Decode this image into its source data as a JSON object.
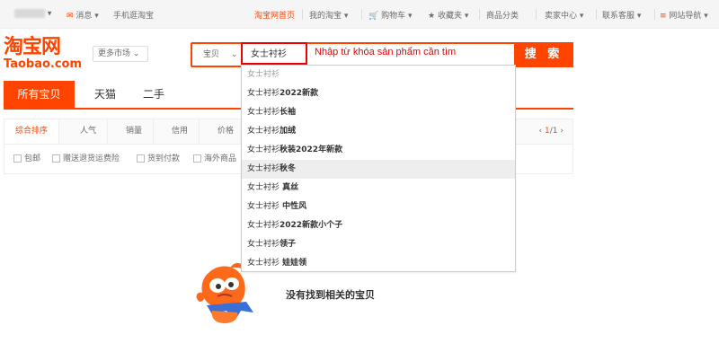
{
  "topbar": {
    "messages": "消息",
    "mobile": "手机逛淘宝",
    "home": "淘宝网首页",
    "my_taobao": "我的淘宝",
    "cart": "购物车",
    "favorites": "收藏夹",
    "categories": "商品分类",
    "seller_center": "卖家中心",
    "support": "联系客服",
    "site_nav": "网站导航"
  },
  "logo": {
    "cn": "淘宝网",
    "en": "Taobao.com"
  },
  "market_button": "更多市场",
  "search": {
    "type": "宝贝",
    "value": "女士衬衫",
    "button": "搜 索",
    "annotation": "Nhập từ khóa sản phẩm cần tìm"
  },
  "tabs": [
    "所有宝贝",
    "天猫",
    "二手"
  ],
  "sort": [
    "综合排序",
    "人气",
    "销量",
    "信用",
    "价格"
  ],
  "pager": {
    "current": "1",
    "total": "/1"
  },
  "filters": [
    "包邮",
    "赠送退货运费险",
    "货到付款",
    "海外商品"
  ],
  "suggestions": [
    {
      "prefix": "女士衬衫",
      "suffix": ""
    },
    {
      "prefix": "女士衬衫",
      "suffix": "2022新款"
    },
    {
      "prefix": "女士衬衫",
      "suffix": "长袖"
    },
    {
      "prefix": "女士衬衫",
      "suffix": "加绒"
    },
    {
      "prefix": "女士衬衫",
      "suffix": "秋装2022年新款"
    },
    {
      "prefix": "女士衬衫",
      "suffix": "秋冬"
    },
    {
      "prefix": "女士衬衫",
      "suffix": " 真丝"
    },
    {
      "prefix": "女士衬衫",
      "suffix": " 中性风"
    },
    {
      "prefix": "女士衬衫",
      "suffix": "2022新款小个子"
    },
    {
      "prefix": "女士衬衫",
      "suffix": "领子"
    },
    {
      "prefix": "女士衬衫",
      "suffix": " 娃娃领"
    }
  ],
  "empty_message": "没有找到相关的宝贝",
  "colors": {
    "accent": "#ff4400",
    "annotation": "#ee0000"
  },
  "icons": [
    "mail-icon",
    "cart-icon",
    "star-icon",
    "menu-icon",
    "chevron-down-icon",
    "chevron-left-icon",
    "chevron-right-icon",
    "mascot-icon"
  ]
}
